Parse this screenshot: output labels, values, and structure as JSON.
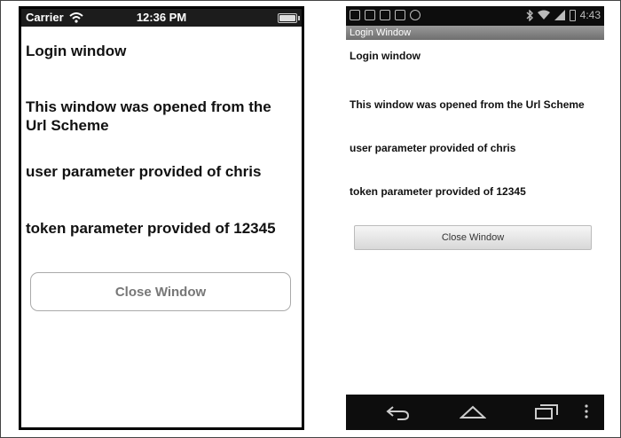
{
  "ios": {
    "status": {
      "carrier": "Carrier",
      "time": "12:36 PM"
    },
    "title": "Login window",
    "message1": "This window was opened from the Url Scheme",
    "message2": "user parameter provided of chris",
    "message3": "token parameter provided of 12345",
    "close_button": "Close Window"
  },
  "android": {
    "status": {
      "time": "4:43"
    },
    "window_title": "Login Window",
    "title": "Login window",
    "message1": "This window was opened from the Url Scheme",
    "message2": "user parameter provided of chris",
    "message3": "token parameter provided of 12345",
    "close_button": "Close Window"
  },
  "icons": {
    "ios_status": [
      "wifi-icon",
      "battery-icon"
    ],
    "android_status": [
      "image-icon",
      "video-icon",
      "photo-icon",
      "play-icon",
      "game-icon",
      "bluetooth-icon",
      "wifi-icon",
      "signal-icon",
      "battery-icon"
    ],
    "android_nav": [
      "back-icon",
      "home-icon",
      "recent-apps-icon",
      "overflow-menu-icon"
    ]
  }
}
